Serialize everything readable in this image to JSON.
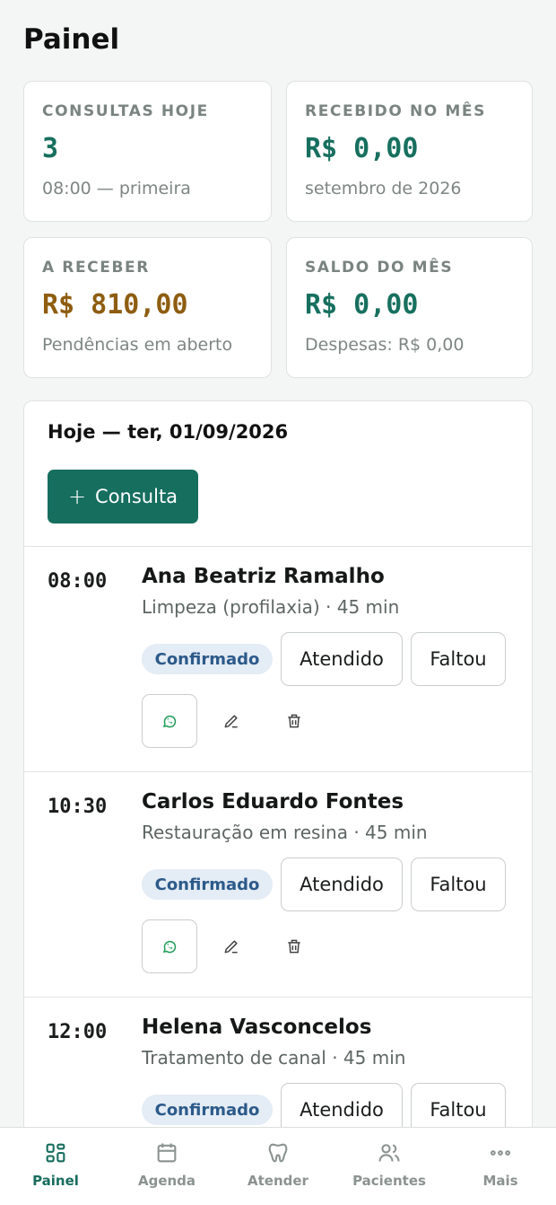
{
  "page": {
    "title": "Painel"
  },
  "stats": [
    {
      "label": "CONSULTAS HOJE",
      "value": "3",
      "sub": "08:00 — primeira",
      "tone": "green"
    },
    {
      "label": "RECEBIDO NO MÊS",
      "value": "R$ 0,00",
      "sub": "setembro de 2026",
      "tone": "green"
    },
    {
      "label": "A RECEBER",
      "value": "R$ 810,00",
      "sub": "Pendências em aberto",
      "tone": "amber"
    },
    {
      "label": "SALDO DO MÊS",
      "value": "R$ 0,00",
      "sub": "Despesas: R$ 0,00",
      "tone": "green"
    }
  ],
  "agenda": {
    "title": "Hoje — ter, 01/09/2026",
    "new_button": {
      "icon": "plus-icon",
      "label": "Consulta"
    },
    "appointments": [
      {
        "time": "08:00",
        "name": "Ana Beatriz Ramalho",
        "desc": "Limpeza (profilaxia) · 45 min",
        "status": "Confirmado",
        "attended_label": "Atendido",
        "missed_label": "Faltou"
      },
      {
        "time": "10:30",
        "name": "Carlos Eduardo Fontes",
        "desc": "Restauração em resina · 45 min",
        "status": "Confirmado",
        "attended_label": "Atendido",
        "missed_label": "Faltou"
      },
      {
        "time": "12:00",
        "name": "Helena Vasconcelos",
        "desc": "Tratamento de canal · 45 min",
        "status": "Confirmado",
        "attended_label": "Atendido",
        "missed_label": "Faltou"
      }
    ]
  },
  "nav": {
    "items": [
      {
        "label": "Painel",
        "icon": "grid-icon",
        "active": true
      },
      {
        "label": "Agenda",
        "icon": "calendar-icon",
        "active": false
      },
      {
        "label": "Atender",
        "icon": "tooth-icon",
        "active": false
      },
      {
        "label": "Pacientes",
        "icon": "users-icon",
        "active": false
      },
      {
        "label": "Mais",
        "icon": "more-icon",
        "active": false
      }
    ]
  },
  "colors": {
    "accent": "#166e5f",
    "green_value": "#17705f",
    "amber_value": "#8e5d10",
    "badge_bg": "#e4ecf5",
    "badge_text": "#2c5a8a",
    "whatsapp": "#1f9d55"
  }
}
